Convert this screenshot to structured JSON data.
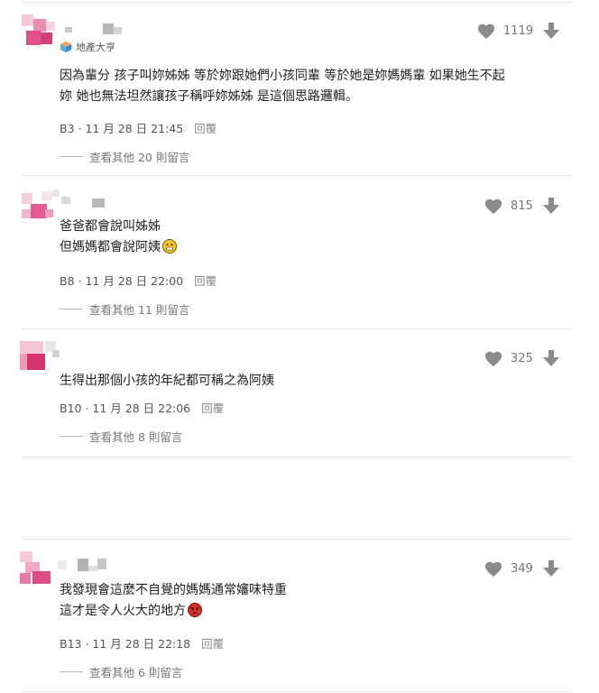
{
  "comments": [
    {
      "badge": "地產大亨",
      "lines": [
        "因為輩分 孩子叫妳姊姊 等於妳跟她們小孩同輩 等於她是妳媽媽輩 如果她生不起",
        "妳 她也無法坦然讓孩子稱呼妳姊姊 是這個思路邏輯。"
      ],
      "floor": "B3",
      "datetime": "11 月 28 日 21:45",
      "reply": "回覆",
      "likes": "1119",
      "more": "查看其他 20 則留言"
    },
    {
      "lines": [
        "爸爸都會說叫姊姊",
        "但媽媽都會說阿姨"
      ],
      "emoji": "grimace-emoji",
      "floor": "B8",
      "datetime": "11 月 28 日 22:00",
      "reply": "回覆",
      "likes": "815",
      "more": "查看其他 11 則留言"
    },
    {
      "lines": [
        "生得出那個小孩的年紀都可稱之為阿姨"
      ],
      "floor": "B10",
      "datetime": "11 月 28 日 22:06",
      "reply": "回覆",
      "likes": "325",
      "more": "查看其他 8 則留言"
    },
    {
      "lines": [
        "我發現會這麼不自覺的媽媽通常嬸味特重",
        "這才是令人火大的地方"
      ],
      "emoji": "angry-emoji",
      "floor": "B13",
      "datetime": "11 月 28 日 22:18",
      "reply": "回覆",
      "likes": "349",
      "more": "查看其他 6 則留言"
    }
  ],
  "colors": {
    "avatar_pink": "#e8578e",
    "icon_gray": "#8a8a8a",
    "text": "#222222",
    "meta": "#555555"
  }
}
